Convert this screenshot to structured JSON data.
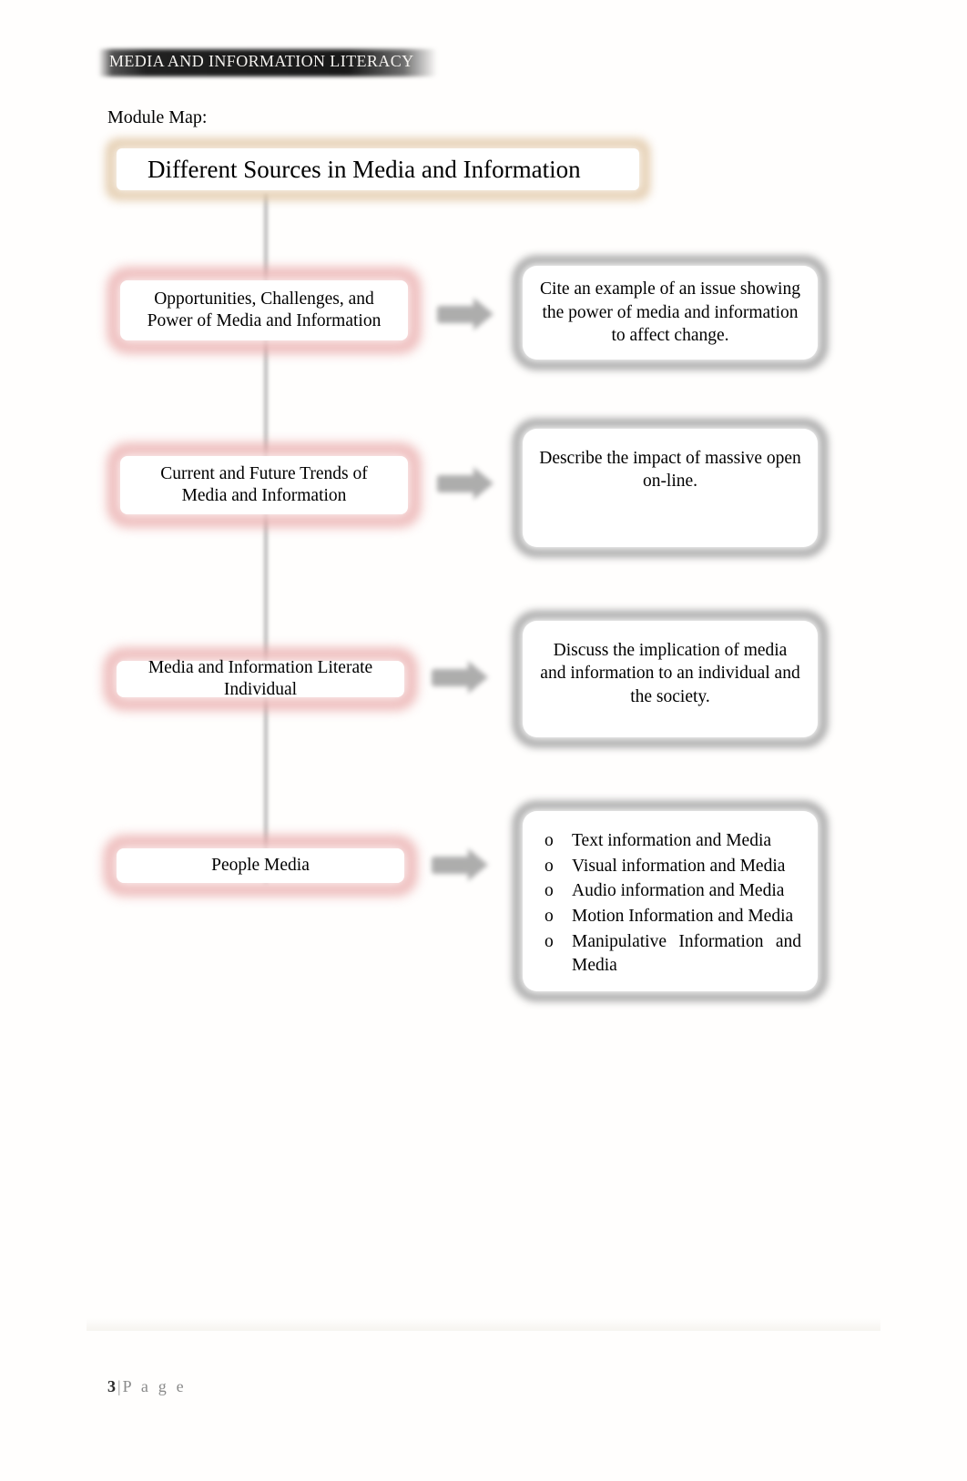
{
  "header": {
    "running_title": "MEDIA AND INFORMATION LITERACY"
  },
  "body": {
    "section_label": "Module Map:",
    "title_box": {
      "text": "Different Sources in Media and Information"
    },
    "rows": [
      {
        "topic": "Opportunities, Challenges, and\nPower of Media and Information",
        "arrow": "right-arrow-icon",
        "outcome": "Cite an example of an issue showing the power of media and information to affect change."
      },
      {
        "topic": "Current and Future Trends of\nMedia and Information",
        "arrow": "right-arrow-icon",
        "outcome": "Describe the impact of massive open on-line."
      },
      {
        "topic": "Media and Information Literate\nIndividual",
        "arrow": "right-arrow-icon",
        "outcome": "Discuss the implication of media and information to an individual and the society."
      },
      {
        "topic": "People Media",
        "arrow": "right-arrow-icon",
        "outcome_list": [
          "Text information and Media",
          "Visual information and Media",
          "Audio information and Media",
          "Motion Information and Media",
          "Manipulative Information and Media"
        ],
        "bullet_marker": "o"
      }
    ]
  },
  "footer": {
    "page_number": "3",
    "separator": "|",
    "page_word": "P a g e"
  },
  "colors": {
    "rose_border": "#e8a5a5",
    "tan_border": "#e0c6a4",
    "gray_border": "#9d9d9d",
    "header_band": "#141414",
    "arrow": "#8e8e8e",
    "footer_text": "#8a8a8a"
  }
}
